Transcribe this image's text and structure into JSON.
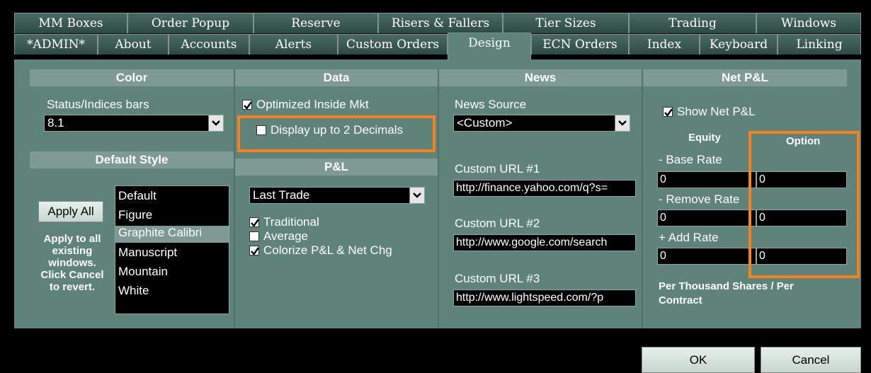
{
  "tabs_row1": [
    "MM Boxes",
    "Order Popup",
    "Reserve",
    "Risers & Fallers",
    "Tier Sizes",
    "Trading",
    "Windows"
  ],
  "tabs_row2": [
    "*ADMIN*",
    "About",
    "Accounts",
    "Alerts",
    "Custom Orders",
    "Design",
    "ECN Orders",
    "Index",
    "Keyboard",
    "Linking"
  ],
  "active_tab": "Design",
  "color": {
    "header": "Color",
    "status_label": "Status/Indices bars",
    "status_value": "8.1"
  },
  "default_style": {
    "header": "Default Style",
    "apply_all": "Apply All",
    "note_lines": [
      "Apply to all",
      "existing",
      "windows.",
      "Click Cancel",
      "to revert."
    ],
    "styles": [
      "Default",
      "Figure",
      "Graphite Calibri",
      "Manuscript",
      "Mountain",
      "White"
    ],
    "selected": "Graphite Calibri"
  },
  "data": {
    "header": "Data",
    "optimized": "Optimized Inside Mkt",
    "optimized_checked": true,
    "decimals": "Display up to 2 Decimals",
    "decimals_checked": false
  },
  "pnl": {
    "header": "P&L",
    "mode": "Last Trade",
    "traditional": "Traditional",
    "average": "Average",
    "colorize": "Colorize P&L & Net Chg"
  },
  "news": {
    "header": "News",
    "source_label": "News Source",
    "source_value": "<Custom>",
    "url1_label": "Custom URL #1",
    "url1": "http://finance.yahoo.com/q?s=",
    "url2_label": "Custom URL #2",
    "url2": "http://www.google.com/search",
    "url3_label": "Custom URL #3",
    "url3": "http://www.lightspeed.com/?p"
  },
  "netpnl": {
    "header": "Net P&L",
    "show": "Show Net P&L",
    "equity": "Equity",
    "option": "Option",
    "base_rate": "- Base Rate",
    "remove_rate": "- Remove Rate",
    "add_rate": "+ Add Rate",
    "base_eq": "0",
    "base_opt": "0",
    "remove_eq": "0",
    "remove_opt": "0",
    "add_eq": "0",
    "add_opt": "0",
    "footnote_1": "Per Thousand Shares / Per",
    "footnote_2": "Contract"
  },
  "buttons": {
    "ok": "OK",
    "cancel": "Cancel"
  },
  "colors": {
    "panel": "#5f8279",
    "header": "#7e9a93",
    "highlight": "#f58220"
  }
}
